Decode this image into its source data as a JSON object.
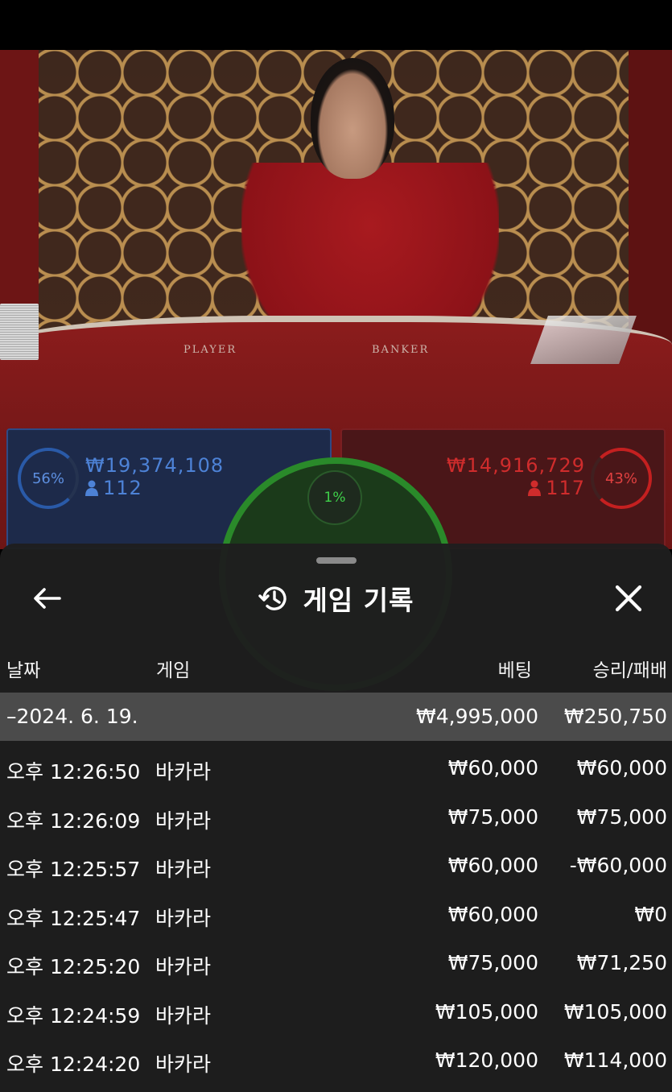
{
  "table": {
    "felt_labels": [
      "PLAYER",
      "BANKER"
    ]
  },
  "betting": {
    "player": {
      "percent": "56%",
      "amount": "₩19,374,108",
      "players": "112",
      "color": "#2a5aa8"
    },
    "tie": {
      "percent": "1%",
      "color": "#2a8a2a"
    },
    "banker": {
      "percent": "43%",
      "amount": "₩14,916,729",
      "players": "117",
      "color": "#c42020"
    }
  },
  "history": {
    "title": "게임 기록",
    "icons": {
      "back": "back-arrow-icon",
      "history": "history-clock-icon",
      "close": "close-icon"
    },
    "columns": {
      "date": "날짜",
      "game": "게임",
      "bet": "베팅",
      "result": "승리/패배"
    },
    "summary": {
      "date": "–2024. 6. 19.",
      "bet": "₩4,995,000",
      "result": "₩250,750"
    },
    "rows": [
      {
        "time": "오후 12:26:50",
        "game": "바카라",
        "bet": "₩60,000",
        "result": "₩60,000"
      },
      {
        "time": "오후 12:26:09",
        "game": "바카라",
        "bet": "₩75,000",
        "result": "₩75,000"
      },
      {
        "time": "오후 12:25:57",
        "game": "바카라",
        "bet": "₩60,000",
        "result": "-₩60,000"
      },
      {
        "time": "오후 12:25:47",
        "game": "바카라",
        "bet": "₩60,000",
        "result": "₩0"
      },
      {
        "time": "오후 12:25:20",
        "game": "바카라",
        "bet": "₩75,000",
        "result": "₩71,250"
      },
      {
        "time": "오후 12:24:59",
        "game": "바카라",
        "bet": "₩105,000",
        "result": "₩105,000"
      },
      {
        "time": "오후 12:24:20",
        "game": "바카라",
        "bet": "₩120,000",
        "result": "₩114,000"
      }
    ]
  }
}
